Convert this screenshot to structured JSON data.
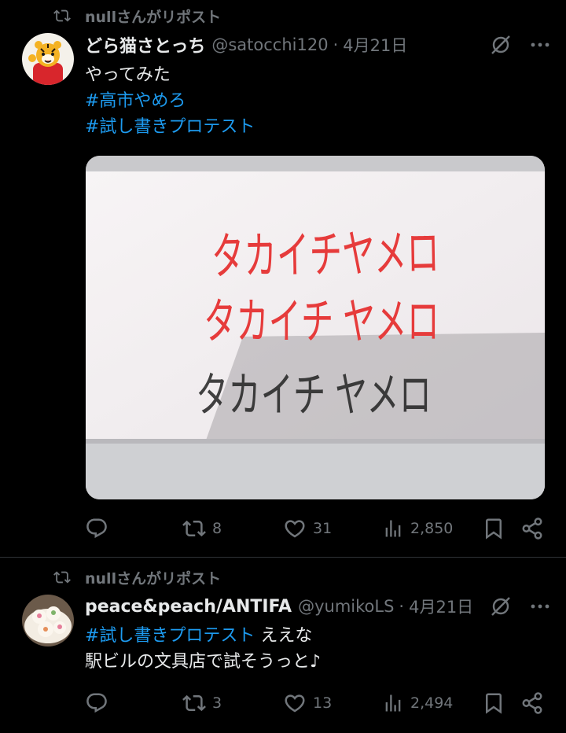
{
  "posts": [
    {
      "repost_text": "nullさんがリポスト",
      "author_name": "どら猫さとっち",
      "handle": "@satocchi120",
      "separator": "·",
      "date": "4月21日",
      "text_line": "やってみた",
      "hashtags": [
        "#高市やめろ",
        "#試し書きプロテスト"
      ],
      "image_text_lines": [
        "タカイチヤメロ",
        "タカイチ ヤメロ",
        "タカイチ ヤメロ"
      ],
      "actions": {
        "reply_count": "",
        "repost_count": "8",
        "like_count": "31",
        "view_count": "2,850"
      }
    },
    {
      "repost_text": "nullさんがリポスト",
      "author_name": "peace&peach/ANTIFA",
      "handle": "@yumikoLS",
      "separator": "·",
      "date": "4月21日",
      "hashtag": "#試し書きプロテスト",
      "text_after_hashtag": " ええな",
      "text_line2": "駅ビルの文具店で試そうっと♪",
      "actions": {
        "reply_count": "",
        "repost_count": "3",
        "like_count": "13",
        "view_count": "2,494"
      }
    }
  ],
  "colors": {
    "background": "#000000",
    "text": "#e7e9ea",
    "muted": "#71767b",
    "link": "#1d9bf0",
    "ink_red": "#e63b3b",
    "ink_black": "#222222"
  }
}
